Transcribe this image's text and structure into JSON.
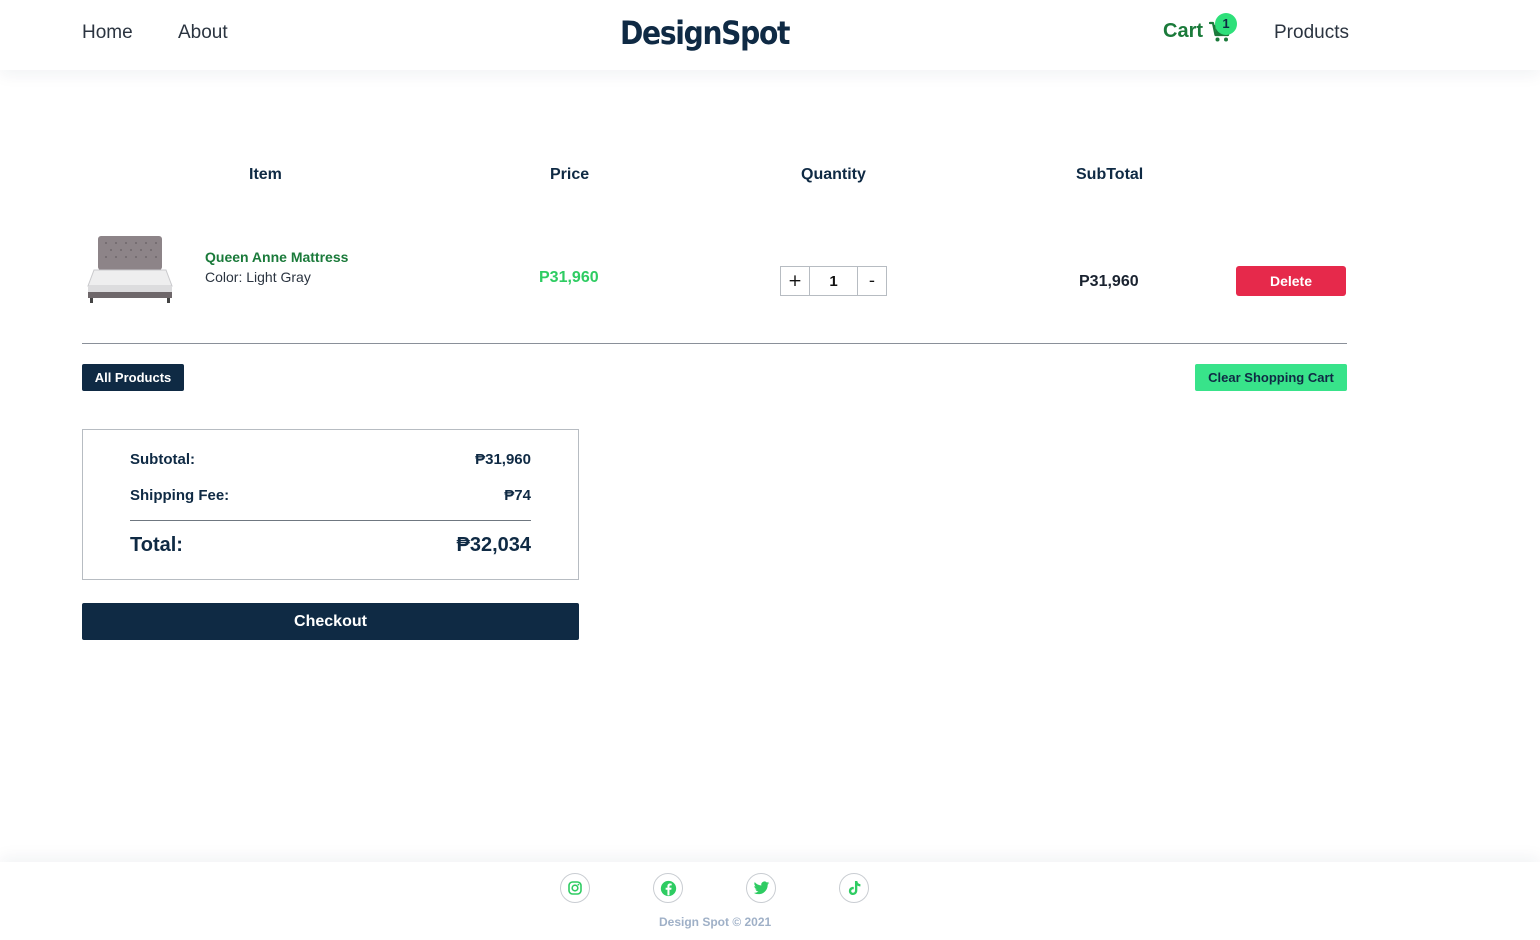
{
  "header": {
    "nav": {
      "home": "Home",
      "about": "About",
      "products": "Products"
    },
    "logo": "DesignSpot",
    "cart_label": "Cart",
    "cart_count": "1"
  },
  "table": {
    "headers": {
      "item": "Item",
      "price": "Price",
      "quantity": "Quantity",
      "subtotal": "SubTotal"
    },
    "rows": [
      {
        "name": "Queen Anne Mattress",
        "color": "Color: Light Gray",
        "price": "P31,960",
        "quantity": "1",
        "subtotal": "P31,960",
        "plus_label": "+",
        "minus_label": "-",
        "delete_label": "Delete"
      }
    ]
  },
  "actions": {
    "all_products": "All Products",
    "clear_cart": "Clear Shopping Cart"
  },
  "totals": {
    "subtotal_label": "Subtotal:",
    "subtotal_value": "₱31,960",
    "shipping_label": "Shipping Fee:",
    "shipping_value": "₱74",
    "total_label": "Total:",
    "total_value": "₱32,034"
  },
  "checkout_label": "Checkout",
  "footer": {
    "icons": [
      "instagram-icon",
      "facebook-icon",
      "twitter-icon",
      "tiktok-icon"
    ],
    "copyright": "Design Spot © 2021"
  },
  "colors": {
    "navy": "#0f2a44",
    "green_text": "#1a7a3a",
    "green_price": "#2ecc62",
    "green_button": "#38e38a",
    "delete_red": "#e6294b"
  }
}
